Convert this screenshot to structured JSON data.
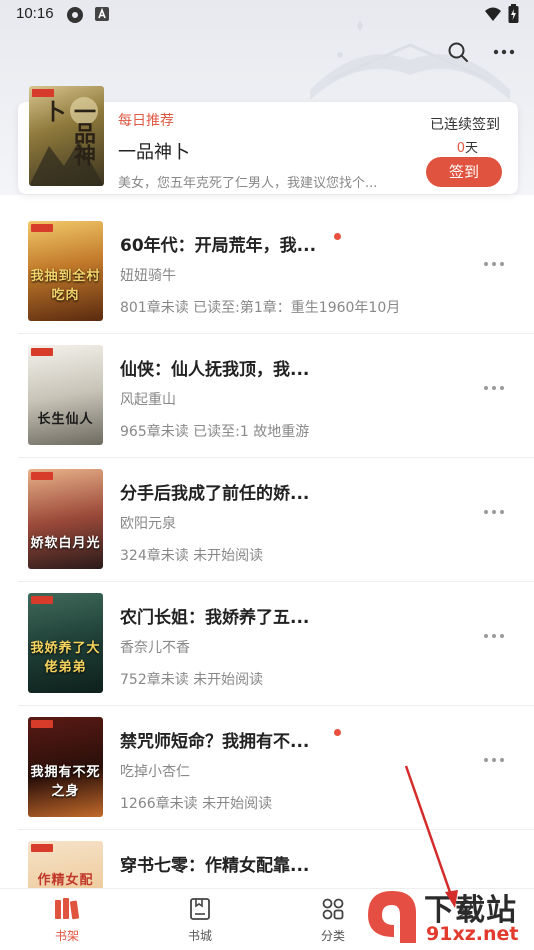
{
  "status_bar": {
    "time": "10:16"
  },
  "daily": {
    "tag": "每日推荐",
    "title": "一品神卜",
    "desc": "美女，您五年克死了仁男人，我建议您找个...",
    "streak_label": "已连续签到",
    "streak_num": "0",
    "streak_unit": "天",
    "signin": "签到",
    "cover_text": "一品神卜"
  },
  "books": [
    {
      "title": "60年代：开局荒年，我...",
      "author": "妞妞骑牛",
      "progress": "801章未读 已读至:第1章：重生1960年10月",
      "unread_dot": true,
      "cover_text": "我抽到全村吃肉"
    },
    {
      "title": "仙侠：仙人抚我顶，我...",
      "author": "风起重山",
      "progress": "965章未读 已读至:1 故地重游",
      "unread_dot": false,
      "cover_text": "长生仙人"
    },
    {
      "title": "分手后我成了前任的娇...",
      "author": "欧阳元泉",
      "progress": "324章未读 未开始阅读",
      "unread_dot": false,
      "cover_text": "娇软白月光"
    },
    {
      "title": "农门长姐：我娇养了五...",
      "author": "香奈儿不香",
      "progress": "752章未读 未开始阅读",
      "unread_dot": false,
      "cover_text": "我娇养了大佬弟弟"
    },
    {
      "title": "禁咒师短命？我拥有不...",
      "author": "吃掉小杏仁",
      "progress": "1266章未读 未开始阅读",
      "unread_dot": true,
      "cover_text": "我拥有不死之身"
    },
    {
      "title": "穿书七零：作精女配靠...",
      "author": "",
      "progress": "",
      "unread_dot": false,
      "cover_text": "作精女配"
    }
  ],
  "nav": [
    {
      "label": "书架",
      "icon": "bookshelf-icon",
      "active": true
    },
    {
      "label": "书城",
      "icon": "bookstore-icon",
      "active": false
    },
    {
      "label": "分类",
      "icon": "category-icon",
      "active": false
    },
    {
      "label": "",
      "icon": "profile-icon",
      "active": false
    }
  ],
  "watermark": {
    "text_cn": "下载站",
    "text_url": "91xz.net"
  },
  "colors": {
    "accent": "#e0533f",
    "dot": "#e6503d"
  }
}
